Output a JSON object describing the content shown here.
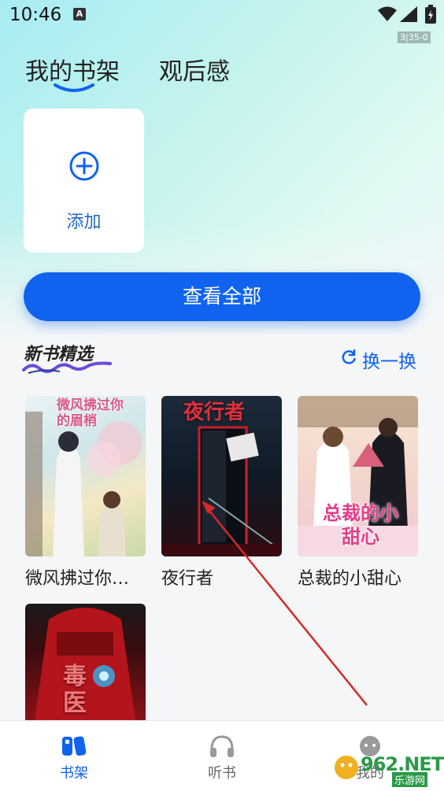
{
  "status_bar": {
    "time": "10:46",
    "notification_icon": "A",
    "build_tag": "3|35-0"
  },
  "tabs": [
    {
      "label": "我的书架",
      "active": true
    },
    {
      "label": "观后感",
      "active": false
    }
  ],
  "shelf": {
    "add_label": "添加",
    "add_icon": "plus-circle-icon"
  },
  "view_all_label": "查看全部",
  "featured": {
    "title": "新书精选",
    "refresh_label": "换一换",
    "refresh_icon": "refresh-icon",
    "books": [
      {
        "name": "微风拂过你…",
        "cover_text": "微风拂过你的眉梢"
      },
      {
        "name": "夜行者",
        "cover_text": "夜行者"
      },
      {
        "name": "总裁的小甜心",
        "cover_text": "总裁的小甜心"
      },
      {
        "name": "",
        "cover_text": "毒医"
      }
    ]
  },
  "bottom_nav": [
    {
      "label": "书架",
      "icon": "bookshelf-icon",
      "active": true
    },
    {
      "label": "听书",
      "icon": "headphones-icon",
      "active": false
    },
    {
      "label": "我的",
      "icon": "profile-icon",
      "active": false
    }
  ],
  "watermark": {
    "text": "962.NET",
    "sub": "乐游网"
  },
  "colors": {
    "accent": "#0f63ee",
    "add_label": "#2268c9",
    "annotation_arrow": "#d42a2a"
  }
}
